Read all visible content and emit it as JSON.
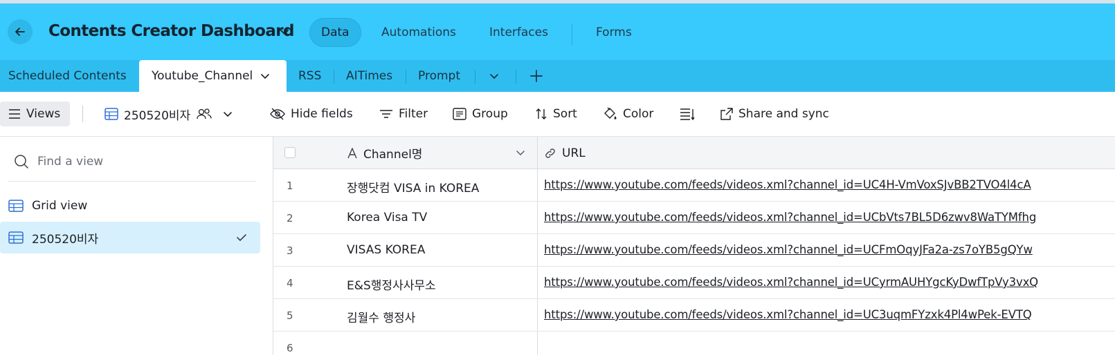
{
  "header": {
    "title": "Contents Creator Dashboard",
    "nav": [
      "Data",
      "Automations",
      "Interfaces",
      "Forms"
    ]
  },
  "tables": {
    "tabs": [
      "Scheduled Contents",
      "Youtube_Channel",
      "RSS",
      "AITimes",
      "Prompt"
    ]
  },
  "toolbar": {
    "views_label": "Views",
    "current_view": "250520비자",
    "hide_fields": "Hide fields",
    "filter": "Filter",
    "group": "Group",
    "sort": "Sort",
    "color": "Color",
    "share": "Share and sync"
  },
  "sidebar": {
    "search_placeholder": "Find a view",
    "views": [
      "Grid view",
      "250520비자"
    ]
  },
  "grid": {
    "columns": [
      "Channel명",
      "URL"
    ],
    "rows": [
      {
        "num": "1",
        "name": "장행닷컴 VISA in KOREA",
        "url": "https://www.youtube.com/feeds/videos.xml?channel_id=UC4H-VmVoxSJvBB2TVO4l4cA"
      },
      {
        "num": "2",
        "name": "Korea Visa TV",
        "url": "https://www.youtube.com/feeds/videos.xml?channel_id=UCbVts7BL5D6zwv8WaTYMfhg"
      },
      {
        "num": "3",
        "name": "VISAS KOREA",
        "url": "https://www.youtube.com/feeds/videos.xml?channel_id=UCFmOqyJFa2a-zs7oYB5gQYw"
      },
      {
        "num": "4",
        "name": "E&S행정사사무소",
        "url": "https://www.youtube.com/feeds/videos.xml?channel_id=UCyrmAUHYgcKyDwfTpVy3vxQ"
      },
      {
        "num": "5",
        "name": "김월수 행정사",
        "url": "https://www.youtube.com/feeds/videos.xml?channel_id=UC3uqmFYzxk4Pl4wPek-EVTQ"
      },
      {
        "num": "6",
        "name": "",
        "url": ""
      }
    ]
  },
  "colors": {
    "header_bg": "#38c9fd",
    "tabbar_bg": "#2fbdf0",
    "selected_view_bg": "#d6f1fd",
    "table_icon": "#2d6fd6"
  },
  "icons": [
    "back-arrow-icon",
    "chevron-down-icon",
    "plus-icon",
    "menu-icon",
    "grid-icon",
    "collaborators-icon",
    "eye-off-icon",
    "filter-icon",
    "group-icon",
    "sort-icon",
    "color-bucket-icon",
    "row-height-icon",
    "share-icon",
    "search-icon",
    "checkmark-icon",
    "text-field-icon",
    "link-icon"
  ]
}
